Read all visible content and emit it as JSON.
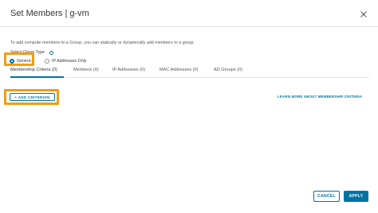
{
  "dialog": {
    "title": "Set Members | g-vm",
    "description": "To add compute members to a Group, you can statically or dynamically add members to a group.",
    "group_type_label": "Select Group Type"
  },
  "group_type": {
    "options": [
      {
        "label": "Generic",
        "selected": true
      },
      {
        "label": "IP Addresses Only",
        "selected": false
      }
    ]
  },
  "tabs": [
    {
      "label": "Membership Criteria (0)",
      "active": true
    },
    {
      "label": "Members (0)",
      "active": false
    },
    {
      "label": "IP Addresses (0)",
      "active": false
    },
    {
      "label": "MAC Addresses (0)",
      "active": false
    },
    {
      "label": "AD Groups (0)",
      "active": false
    }
  ],
  "actions": {
    "add_criterion": "+ ADD CRITERION",
    "learn_more": "LEARN MORE ABOUT MEMBERSHIP CRITERIA",
    "cancel": "CANCEL",
    "apply": "APPLY"
  },
  "colors": {
    "accent": "#0072a3",
    "highlight": "#f39c12"
  },
  "icons": {
    "close": "close-icon",
    "info": "info-icon"
  }
}
